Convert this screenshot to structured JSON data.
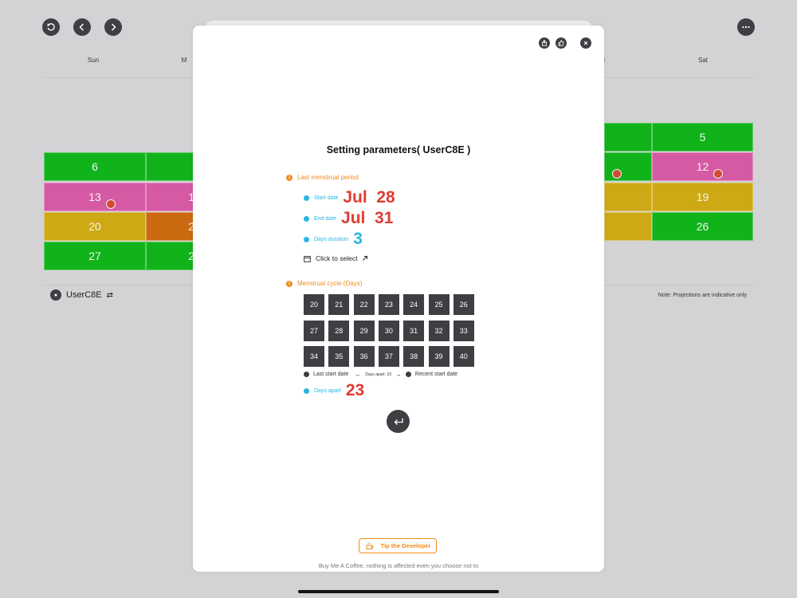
{
  "toolbar": {
    "reset_icon": "rotate-ccw-icon",
    "prev_icon": "chevron-left-icon",
    "next_icon": "chevron-right-icon",
    "more_icon": "ellipsis-icon"
  },
  "calendar": {
    "weekdays": {
      "sun": "Sun",
      "mon_partial": "M",
      "fri_partial": "i",
      "sat": "Sat"
    },
    "cells": {
      "d5": "5",
      "d6": "6",
      "d12": "12",
      "d13": "13",
      "d13n": "1",
      "d19": "19",
      "d20": "20",
      "d21": "2",
      "d26": "26",
      "d27": "27",
      "d28": "2"
    },
    "colors": {
      "period": "#d65aa3",
      "fertile": "#cda915",
      "ovulation": "#cc6a11",
      "safe": "#11b31b"
    }
  },
  "footer": {
    "user": "UserC8E",
    "note": "Note: Projections are indicative only"
  },
  "modal": {
    "title": "Setting parameters( UserC8E )",
    "section1": {
      "num": "1",
      "label": "Last menstrual period"
    },
    "start": {
      "label": "Start date",
      "value": "Jul  28"
    },
    "end": {
      "label": "End date",
      "value": "Jul  31"
    },
    "duration": {
      "label": "Days duration",
      "value": "3"
    },
    "select_label": "Click to select",
    "section2": {
      "num": "2",
      "label": "Menstrual cycle (Days)"
    },
    "cycle_options": [
      "20",
      "21",
      "22",
      "23",
      "24",
      "25",
      "26",
      "27",
      "28",
      "29",
      "30",
      "31",
      "32",
      "33",
      "34",
      "35",
      "36",
      "37",
      "38",
      "39",
      "40"
    ],
    "legend": {
      "last": "Last start date",
      "apart_small": "Days apart: 23",
      "recent": "Recent start date"
    },
    "apart": {
      "label": "Days apart",
      "value": "23"
    },
    "tip_label": "Tip the Developer",
    "coffee_note": "Buy Me A Coffee, nothing is affected even you choose not to"
  }
}
